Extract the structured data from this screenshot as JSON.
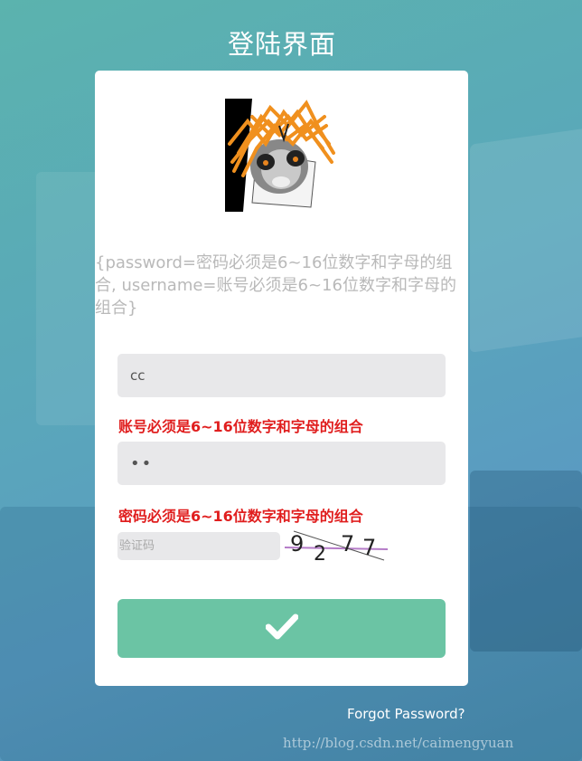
{
  "page": {
    "title": "登陆界面"
  },
  "errors_dump": "{password=密码必须是6~16位数字和字母的组合, username=账号必须是6~16位数字和字母的组合}",
  "form": {
    "username_value": "cc",
    "password_value": "••",
    "username_error": "账号必须是6~16位数字和字母的组合",
    "password_error": "密码必须是6~16位数字和字母的组合",
    "captcha_placeholder": "验证码",
    "captcha_text": "9277",
    "submit_icon": "check-icon"
  },
  "links": {
    "forgot_password": "Forgot Password?"
  },
  "watermark": "http://blog.csdn.net/caimengyuan",
  "colors": {
    "submit_bg": "#6bc4a4",
    "error_text": "#e01e1e",
    "field_bg": "#e8e8ea"
  }
}
